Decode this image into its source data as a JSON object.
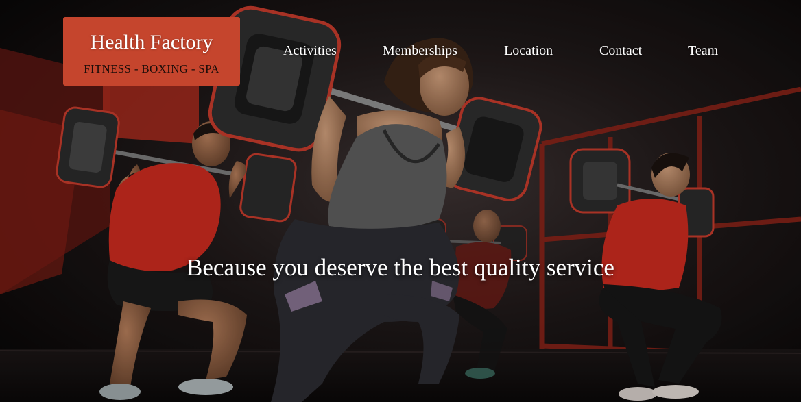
{
  "brand": {
    "name": "Health Factory",
    "tagline": "FITNESS - BOXING - SPA",
    "color": "#c5452d"
  },
  "nav": {
    "items": [
      {
        "label": "Activities"
      },
      {
        "label": "Memberships"
      },
      {
        "label": "Location"
      },
      {
        "label": "Contact"
      },
      {
        "label": "Team"
      }
    ]
  },
  "hero": {
    "headline": "Because you deserve the best quality service",
    "image": "group-fitness-squat-barbell-photo",
    "accent_color": "#c0392b"
  }
}
